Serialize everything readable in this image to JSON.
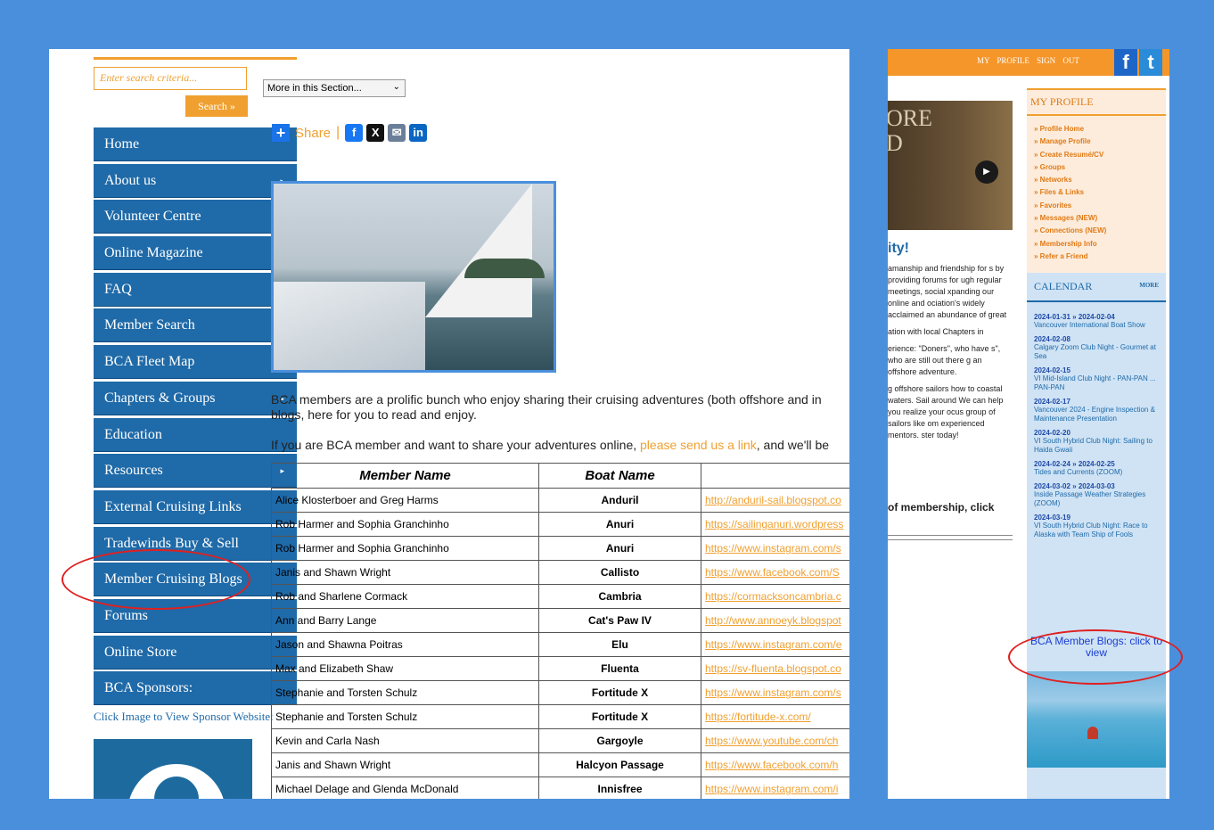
{
  "search": {
    "placeholder": "Enter search criteria...",
    "button": "Search »"
  },
  "nav": [
    {
      "label": "Home",
      "submenu": false
    },
    {
      "label": "About us",
      "submenu": true
    },
    {
      "label": "Volunteer Centre",
      "submenu": true
    },
    {
      "label": "Online Magazine",
      "submenu": false
    },
    {
      "label": "FAQ",
      "submenu": false
    },
    {
      "label": "Member Search",
      "submenu": false
    },
    {
      "label": "BCA Fleet Map",
      "submenu": true
    },
    {
      "label": "Chapters & Groups",
      "submenu": true
    },
    {
      "label": "Education",
      "submenu": false
    },
    {
      "label": "Resources",
      "submenu": true
    },
    {
      "label": "External Cruising Links",
      "submenu": false
    },
    {
      "label": "Tradewinds Buy & Sell",
      "submenu": false
    },
    {
      "label": "Member Cruising Blogs",
      "submenu": false
    },
    {
      "label": "Forums",
      "submenu": false
    },
    {
      "label": "Online Store",
      "submenu": false
    },
    {
      "label": "BCA Sponsors:",
      "submenu": false
    }
  ],
  "sponsor_caption": "Click Image to View Sponsor Website:",
  "section_select": "More in this Section...",
  "share": {
    "label": "Share"
  },
  "intro": {
    "line1": "BCA members are a prolific bunch who enjoy sharing their cruising adventures (both offshore and in",
    "line2": "blogs, here for you to read and enjoy.",
    "line3_pre": "If you are BCA member and want to share your adventures online, ",
    "line3_link": "please send us a link",
    "line3_post": ", and we'll be"
  },
  "table": {
    "headers": [
      "Member Name",
      "Boat Name",
      ""
    ],
    "rows": [
      [
        "Alice Klosterboer and Greg Harms",
        "Anduril",
        "http://anduril-sail.blogspot.co"
      ],
      [
        "Rob Harmer and Sophia Granchinho",
        "Anuri",
        "https://sailinganuri.wordpress"
      ],
      [
        "Rob Harmer and Sophia Granchinho",
        "Anuri",
        "https://www.instagram.com/s"
      ],
      [
        "Janis and Shawn Wright",
        "Callisto",
        "https://www.facebook.com/S"
      ],
      [
        "Rob and Sharlene Cormack",
        "Cambria",
        "https://cormacksoncambria.c"
      ],
      [
        "Ann and Barry Lange",
        "Cat's Paw IV",
        "http://www.annoeyk.blogspot"
      ],
      [
        "Jason and Shawna Poitras",
        "Elu",
        "https://www.instagram.com/e"
      ],
      [
        "Max and Elizabeth Shaw",
        "Fluenta",
        "https://sv-fluenta.blogspot.co"
      ],
      [
        "Stephanie and Torsten Schulz",
        "Fortitude X",
        "https://www.instagram.com/s"
      ],
      [
        "Stephanie and Torsten Schulz",
        "Fortitude X",
        "https://fortitude-x.com/"
      ],
      [
        "Kevin and Carla Nash",
        "Gargoyle",
        "https://www.youtube.com/ch"
      ],
      [
        "Janis and Shawn Wright",
        "Halcyon Passage",
        "https://www.facebook.com/h"
      ],
      [
        "Michael Delage and Glenda McDonald",
        "Innisfree",
        "https://www.instagram.com/i"
      ]
    ]
  },
  "right": {
    "topbar_links": "MY PROFILE   SIGN OUT",
    "video_text": "ORE\nD",
    "heading": "ity!",
    "para1": "amanship and friendship for s by providing forums for ugh regular meetings, social xpanding our online and ociation's widely acclaimed an abundance of great",
    "para2": "ation with local Chapters in",
    "para3": "erience: \"Doners\", who have s\", who are still out there g an offshore adventure.",
    "para4": "g offshore sailors how to coastal waters. Sail around We can help you realize your ocus group of sailors like om experienced mentors. ster today!",
    "bold": "of membership, click",
    "profile_heading": "MY PROFILE",
    "profile_links": [
      "» Profile Home",
      "» Manage Profile",
      "» Create Resumé/CV",
      "» Groups",
      "» Networks",
      "» Files & Links",
      "» Favorites",
      "» Messages (NEW)",
      "» Connections (NEW)",
      "» Membership Info",
      "» Refer a Friend"
    ],
    "calendar_heading": "CALENDAR",
    "calendar_more": "MORE",
    "events": [
      {
        "date": "2024-01-31 » 2024-02-04",
        "title": "Vancouver International Boat Show"
      },
      {
        "date": "2024-02-08",
        "title": "Calgary Zoom Club Night - Gourmet at Sea"
      },
      {
        "date": "2024-02-15",
        "title": "VI Mid-Island Club Night - PAN-PAN ... PAN-PAN"
      },
      {
        "date": "2024-02-17",
        "title": "Vancouver 2024 - Engine Inspection & Maintenance Presentation"
      },
      {
        "date": "2024-02-20",
        "title": "VI South Hybrid Club Night: Sailing to Haida Gwaii"
      },
      {
        "date": "2024-02-24 » 2024-02-25",
        "title": "Tides and Currents (ZOOM)"
      },
      {
        "date": "2024-03-02 » 2024-03-03",
        "title": "Inside Passage Weather Strategies (ZOOM)"
      },
      {
        "date": "2024-03-19",
        "title": "VI South Hybrid Club Night: Race to Alaska with Team Ship of Fools"
      }
    ],
    "blogs_link": "BCA Member Blogs: click to view"
  },
  "colors": {
    "background": "#4a8fdc",
    "nav_blue": "#1f6aa8",
    "accent_orange": "#f0a030",
    "highlight_red": "#e02020"
  }
}
